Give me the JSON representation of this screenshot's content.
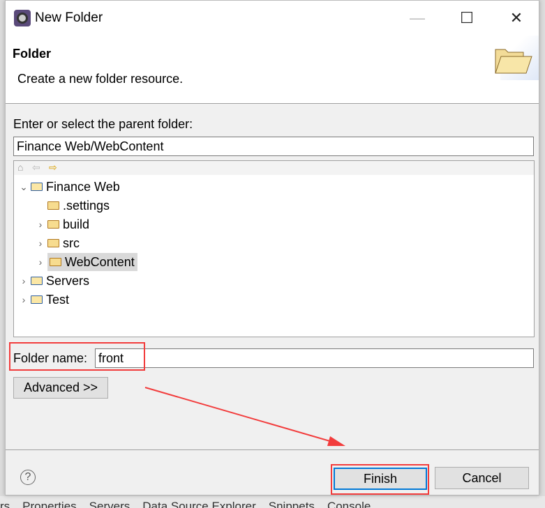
{
  "background_tabs": [
    "rs",
    "Properties",
    "Servers",
    "Data Source Explorer",
    "Snippets",
    "Console"
  ],
  "window": {
    "title": "New Folder",
    "minimize": "—",
    "maximize": "☐",
    "close": "✕"
  },
  "header": {
    "title": "Folder",
    "description": "Create a new folder resource."
  },
  "parent": {
    "label": "Enter or select the parent folder:",
    "value": "Finance Web/WebContent"
  },
  "tree": {
    "nav": {
      "home": "⌂",
      "back": "⇦",
      "forward": "⇨"
    },
    "items": [
      {
        "label": "Finance Web",
        "level": 0,
        "expanded": true,
        "type": "project"
      },
      {
        "label": ".settings",
        "level": 1,
        "type": "folder"
      },
      {
        "label": "build",
        "level": 1,
        "type": "folder",
        "collapsed": true
      },
      {
        "label": "src",
        "level": 1,
        "type": "folder",
        "collapsed": true
      },
      {
        "label": "WebContent",
        "level": 1,
        "type": "folder",
        "collapsed": true,
        "selected": true
      },
      {
        "label": "Servers",
        "level": 0,
        "type": "project",
        "collapsed": true
      },
      {
        "label": "Test",
        "level": 0,
        "type": "project",
        "collapsed": true
      }
    ]
  },
  "folder_name": {
    "label": "Folder name:",
    "value": "front"
  },
  "buttons": {
    "advanced": "Advanced >>",
    "finish": "Finish",
    "cancel": "Cancel",
    "help": "?"
  },
  "colors": {
    "annotation": "#f23c3c",
    "focus": "#0078d7"
  }
}
